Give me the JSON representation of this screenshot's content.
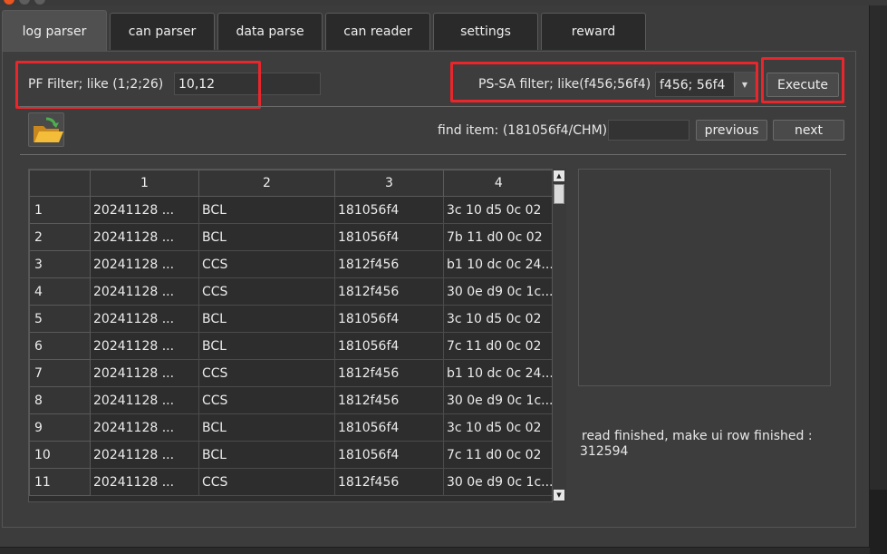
{
  "tabs": [
    {
      "label": "log parser",
      "active": true
    },
    {
      "label": "can parser",
      "active": false
    },
    {
      "label": "data parse",
      "active": false
    },
    {
      "label": "can reader",
      "active": false
    },
    {
      "label": "settings",
      "active": false
    },
    {
      "label": "reward",
      "active": false
    }
  ],
  "filters": {
    "pf_label": "PF Filter;   like (1;2;26)",
    "pf_value": "10,12",
    "pssa_label": "PS-SA filter; like(f456;56f4)",
    "pssa_value": "f456; 56f4",
    "execute_label": "Execute"
  },
  "find": {
    "label": "find item: (181056f4/CHM)",
    "value": "",
    "previous_label": "previous",
    "next_label": "next"
  },
  "table": {
    "columns": [
      "1",
      "2",
      "3",
      "4"
    ],
    "rows": [
      {
        "num": "1",
        "c1": "20241128 ...",
        "c2": "BCL",
        "c3": "181056f4",
        "c4": "3c 10 d5 0c 02"
      },
      {
        "num": "2",
        "c1": "20241128 ...",
        "c2": "BCL",
        "c3": "181056f4",
        "c4": "7b 11 d0 0c 02"
      },
      {
        "num": "3",
        "c1": "20241128 ...",
        "c2": "CCS",
        "c3": "1812f456",
        "c4": "b1 10 dc 0c 24..."
      },
      {
        "num": "4",
        "c1": "20241128 ...",
        "c2": "CCS",
        "c3": "1812f456",
        "c4": "30 0e d9 0c 1c..."
      },
      {
        "num": "5",
        "c1": "20241128 ...",
        "c2": "BCL",
        "c3": "181056f4",
        "c4": "3c 10 d5 0c 02"
      },
      {
        "num": "6",
        "c1": "20241128 ...",
        "c2": "BCL",
        "c3": "181056f4",
        "c4": "7c 11 d0 0c 02"
      },
      {
        "num": "7",
        "c1": "20241128 ...",
        "c2": "CCS",
        "c3": "1812f456",
        "c4": "b1 10 dc 0c 24..."
      },
      {
        "num": "8",
        "c1": "20241128 ...",
        "c2": "CCS",
        "c3": "1812f456",
        "c4": "30 0e d9 0c 1c..."
      },
      {
        "num": "9",
        "c1": "20241128 ...",
        "c2": "BCL",
        "c3": "181056f4",
        "c4": "3c 10 d5 0c 02"
      },
      {
        "num": "10",
        "c1": "20241128 ...",
        "c2": "BCL",
        "c3": "181056f4",
        "c4": "7c 11 d0 0c 02"
      },
      {
        "num": "11",
        "c1": "20241128 ...",
        "c2": "CCS",
        "c3": "1812f456",
        "c4": "30 0e d9 0c 1c..."
      }
    ]
  },
  "status": {
    "line1": "read finished, make ui row finished :",
    "line2": "312594"
  },
  "icons": {
    "open_folder": "open-folder-icon",
    "dropdown": "chevron-down-icon"
  },
  "colors": {
    "highlight": "#e8262b",
    "background": "#3d3d3d"
  }
}
